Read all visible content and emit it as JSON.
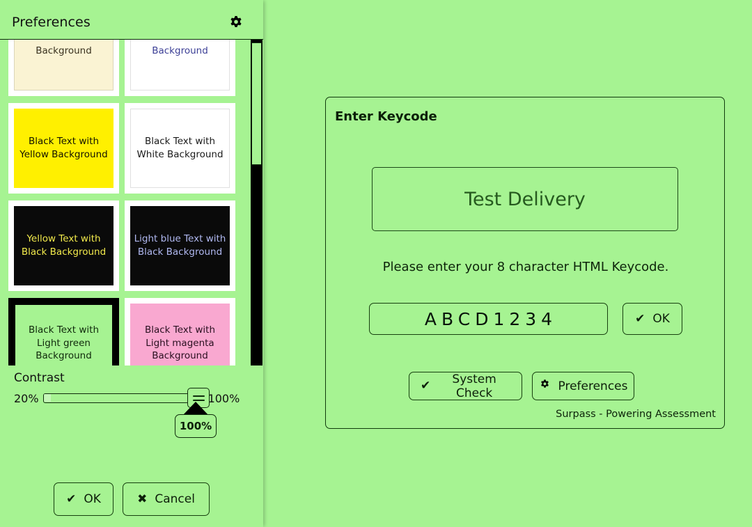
{
  "colors": {
    "app_background": "#A6F392",
    "panel_background": "#A6F392",
    "border": "#103a0c",
    "scrollbar_track": "#000000",
    "scrollbar_thumb": "#A6F392",
    "selected_tile_border": "#000000",
    "tile_frame": "#FFFFFF",
    "test_delivery_text": "#265a1f"
  },
  "preferences_panel": {
    "title": "Preferences",
    "gear_icon": "gear-icon",
    "themes": [
      {
        "label": "Background",
        "bg": "#FAF3D3",
        "fg": "#3a3320",
        "selected": false,
        "partial": true,
        "hairline": true
      },
      {
        "label": "Background",
        "bg": "#FFFFFF",
        "fg": "#3c3f96",
        "selected": false,
        "partial": true,
        "hairline": true
      },
      {
        "label": "Black Text with Yellow Background",
        "bg": "#FFF000",
        "fg": "#141400",
        "selected": false,
        "partial": false,
        "hairline": false
      },
      {
        "label": "Black Text with White Background",
        "bg": "#FFFFFF",
        "fg": "#1a1a1a",
        "selected": false,
        "partial": false,
        "hairline": true
      },
      {
        "label": "Yellow Text with Black Background",
        "bg": "#0A0A0A",
        "fg": "#F2EA4C",
        "selected": false,
        "partial": false,
        "hairline": false
      },
      {
        "label": "Light blue Text with Black Background",
        "bg": "#0A0A0A",
        "fg": "#B0B8F0",
        "selected": false,
        "partial": false,
        "hairline": false
      },
      {
        "label": "Black Text with Light green Background",
        "bg": "#A6F392",
        "fg": "#102a0c",
        "selected": true,
        "partial": false,
        "hairline": false
      },
      {
        "label": "Black Text with Light magenta Background",
        "bg": "#F9A8D0",
        "fg": "#2a1020",
        "selected": false,
        "partial": false,
        "hairline": false
      }
    ],
    "contrast": {
      "label": "Contrast",
      "min_label": "20%",
      "max_label": "100%",
      "value_tooltip": "100%",
      "value": 100
    },
    "footer": {
      "ok_label": "OK",
      "ok_icon": "check-icon",
      "cancel_label": "Cancel",
      "cancel_icon": "cross-icon"
    },
    "scrollbar": {
      "name": "theme-list-scrollbar"
    }
  },
  "keycode_dialog": {
    "title": "Enter Keycode",
    "delivery_box_text": "Test Delivery",
    "instruction": "Please enter your 8 character HTML Keycode.",
    "keycode_value": "ABCD1234",
    "keycode_placeholder": "",
    "ok_label": "OK",
    "ok_icon": "check-icon",
    "system_check_label": "System Check",
    "system_check_icon": "check-icon",
    "preferences_label": "Preferences",
    "preferences_icon": "gear-icon",
    "brand_footer": "Surpass - Powering Assessment"
  }
}
